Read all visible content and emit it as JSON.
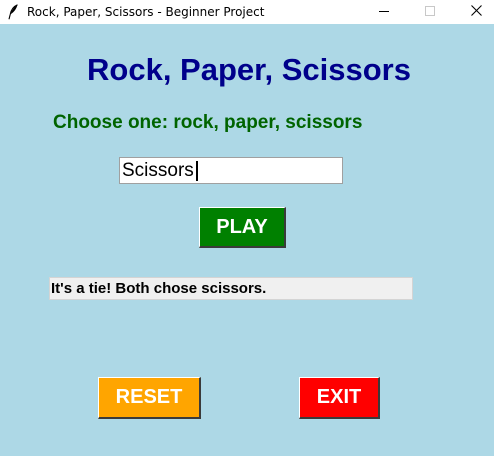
{
  "window": {
    "title": "Rock, Paper, Scissors - Beginner Project",
    "icon": "feather-icon",
    "controls": [
      "minimize-icon",
      "maximize-icon",
      "close-icon"
    ]
  },
  "main": {
    "heading": "Rock, Paper, Scissors",
    "prompt": "Choose one: rock, paper, scissors",
    "choice_value": "Scissors",
    "play_label": "PLAY",
    "result_text": "It's a tie! Both chose scissors.",
    "reset_label": "RESET",
    "exit_label": "EXIT"
  },
  "colors": {
    "background": "#add8e6",
    "heading": "#00008b",
    "prompt": "#006400",
    "play_button": "#008000",
    "reset_button": "#ffa500",
    "exit_button": "#ff0000",
    "result_background": "#f0f0f0"
  }
}
